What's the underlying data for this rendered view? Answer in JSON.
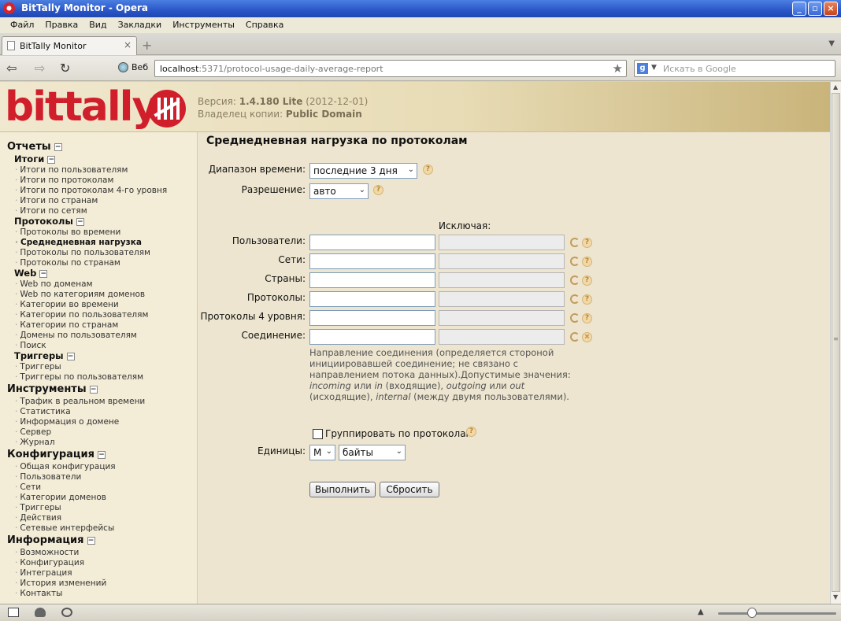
{
  "window": {
    "title": "BitTally Monitor - Opera",
    "minimize": "_",
    "restore": "▫",
    "close": "×"
  },
  "menubar": {
    "items": [
      "Файл",
      "Правка",
      "Вид",
      "Закладки",
      "Инструменты",
      "Справка"
    ]
  },
  "tabs": {
    "active": "BitTally Monitor",
    "close": "×",
    "new": "+"
  },
  "addressbar": {
    "back": "⇦",
    "forward": "⇨",
    "reload": "↻",
    "web_label": "Веб",
    "url_host": "localhost",
    "url_rest": ":5371/protocol-usage-daily-average-report",
    "search_engine": "g",
    "search_placeholder": "Искать в Google"
  },
  "header": {
    "logo_text": "bittally",
    "version_label": "Версия:",
    "version_value": "1.4.180 Lite",
    "version_date": "(2012-12-01)",
    "owner_label": "Владелец копии:",
    "owner_value": "Public Domain"
  },
  "sidebar": {
    "sections": [
      {
        "title": "Отчеты"
      },
      {
        "title": "Инструменты"
      },
      {
        "title": "Конфигурация"
      },
      {
        "title": "Информация"
      }
    ],
    "subsections": [
      "Итоги",
      "Протоколы",
      "Web",
      "Триггеры"
    ],
    "reports_totals": [
      "Итоги по пользователям",
      "Итоги по протоколам",
      "Итоги по протоколам 4-го уровня",
      "Итоги по странам",
      "Итоги по сетям"
    ],
    "reports_protocols": [
      "Протоколы во времени",
      "Среднедневная нагрузка",
      "Протоколы по пользователям",
      "Протоколы по странам"
    ],
    "reports_web": [
      "Web по доменам",
      "Web по категориям доменов",
      "Категории во времени",
      "Категории по пользователям",
      "Категории по странам",
      "Домены по пользователям",
      "Поиск"
    ],
    "reports_triggers": [
      "Триггеры",
      "Триггеры по пользователям"
    ],
    "tools": [
      "Трафик в реальном времени",
      "Статистика",
      "Информация о домене",
      "Сервер",
      "Журнал"
    ],
    "config": [
      "Общая конфигурация",
      "Пользователи",
      "Сети",
      "Категории доменов",
      "Триггеры",
      "Действия",
      "Сетевые интерфейсы"
    ],
    "info": [
      "Возможности",
      "Конфигурация",
      "Интеграция",
      "История изменений",
      "Контакты"
    ]
  },
  "main": {
    "title": "Среднедневная нагрузка по протоколам",
    "time_range_label": "Диапазон времени:",
    "time_range_value": "последние 3 дня",
    "resolution_label": "Разрешение:",
    "resolution_value": "авто",
    "exclude_label": "Исключая:",
    "filters": [
      {
        "label": "Пользователи:"
      },
      {
        "label": "Сети:"
      },
      {
        "label": "Страны:"
      },
      {
        "label": "Протоколы:"
      },
      {
        "label": "Протоколы 4 уровня:"
      },
      {
        "label": "Соединение:"
      }
    ],
    "note_1": "Направление соединения (определяется стороной инициировавшей соединение; не связано с направлением потока данных).Допустимые значения:",
    "note_incoming": "incoming",
    "note_or1": "или",
    "note_in": "in",
    "note_2": "(входящие),",
    "note_outgoing": "outgoing",
    "note_or2": "или",
    "note_out": "out",
    "note_3": "(исходящие),",
    "note_internal": "internal",
    "note_4": "(между двумя пользователями).",
    "group_label": "Группировать по протоколам",
    "units_label": "Единицы:",
    "units_prefix": "M",
    "units_value": "байты",
    "run_button": "Выполнить",
    "reset_button": "Сбросить",
    "help_glyph": "?",
    "clear_glyph": "×"
  }
}
